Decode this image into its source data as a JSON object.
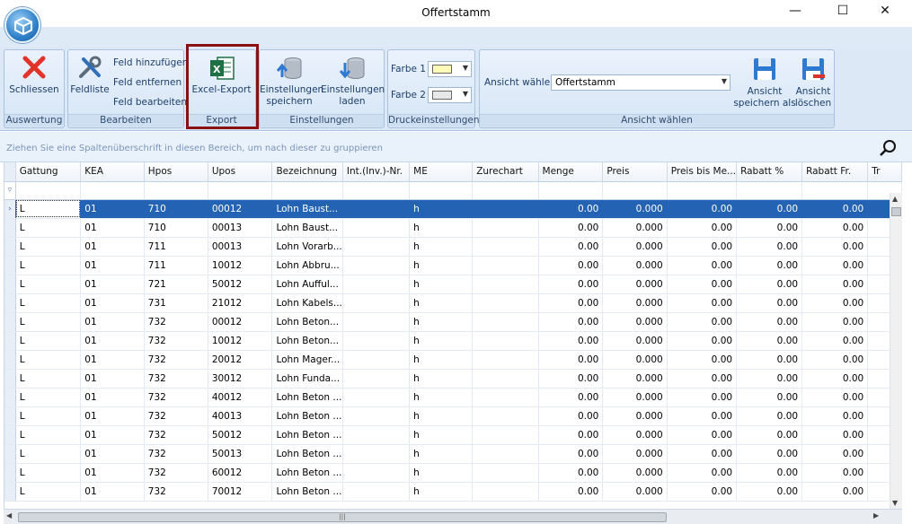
{
  "window": {
    "title": "Offertstamm",
    "minimize_glyph": "—",
    "maximize_glyph": "☐",
    "close_glyph": "✕"
  },
  "ribbon": {
    "auswertung": {
      "label": "Auswertung",
      "schliessen": "Schliessen"
    },
    "bearbeiten": {
      "label": "Bearbeiten",
      "feldliste": "Feldliste",
      "feld_hinzufuegen": "Feld hinzufügen",
      "feld_entfernen": "Feld entfernen",
      "feld_bearbeiten": "Feld bearbeiten"
    },
    "export": {
      "label": "Export",
      "excel_export": "Excel-Export"
    },
    "einstellungen": {
      "label": "Einstellungen",
      "speichern_l1": "Einstellungen",
      "speichern_l2": "speichern",
      "laden_l1": "Einstellungen",
      "laden_l2": "laden"
    },
    "druck": {
      "label": "Druckeinstellungen",
      "farbe1": "Farbe 1",
      "farbe2": "Farbe 2",
      "farbe1_color": "#fffbb8",
      "farbe2_color": "#e8e8e8"
    },
    "ansicht": {
      "label": "Ansicht wählen",
      "ansicht_waehlen": "Ansicht wählen",
      "selected": "Offertstamm",
      "speichern_l1": "Ansicht",
      "speichern_l2": "speichern als",
      "loeschen_l1": "Ansicht",
      "loeschen_l2": "löschen"
    }
  },
  "group_panel": {
    "hint": "Ziehen Sie eine Spaltenüberschrift in diesen Bereich, um nach dieser zu gruppieren"
  },
  "grid": {
    "columns": [
      "Gattung",
      "KEA",
      "Hpos",
      "Upos",
      "Bezeichnung",
      "Int.(Inv.)-Nr.",
      "ME",
      "Zurechart",
      "Menge",
      "Preis",
      "Preis bis Me...",
      "Rabatt %",
      "Rabatt Fr.",
      "Tr"
    ],
    "rows": [
      [
        "L",
        "01",
        "710",
        "00012",
        "Lohn Baust...",
        "",
        "h",
        "",
        "0.00",
        "0.000",
        "0.00",
        "0.00",
        "0.00"
      ],
      [
        "L",
        "01",
        "710",
        "00013",
        "Lohn Baust...",
        "",
        "h",
        "",
        "0.00",
        "0.000",
        "0.00",
        "0.00",
        "0.00"
      ],
      [
        "L",
        "01",
        "711",
        "00013",
        "Lohn Vorarb...",
        "",
        "h",
        "",
        "0.00",
        "0.000",
        "0.00",
        "0.00",
        "0.00"
      ],
      [
        "L",
        "01",
        "711",
        "10012",
        "Lohn Abbru...",
        "",
        "h",
        "",
        "0.00",
        "0.000",
        "0.00",
        "0.00",
        "0.00"
      ],
      [
        "L",
        "01",
        "721",
        "50012",
        "Lohn Aufful...",
        "",
        "h",
        "",
        "0.00",
        "0.000",
        "0.00",
        "0.00",
        "0.00"
      ],
      [
        "L",
        "01",
        "731",
        "21012",
        "Lohn Kabels...",
        "",
        "h",
        "",
        "0.00",
        "0.000",
        "0.00",
        "0.00",
        "0.00"
      ],
      [
        "L",
        "01",
        "732",
        "00012",
        "Lohn Beton...",
        "",
        "h",
        "",
        "0.00",
        "0.000",
        "0.00",
        "0.00",
        "0.00"
      ],
      [
        "L",
        "01",
        "732",
        "10012",
        "Lohn Beton...",
        "",
        "h",
        "",
        "0.00",
        "0.000",
        "0.00",
        "0.00",
        "0.00"
      ],
      [
        "L",
        "01",
        "732",
        "20012",
        "Lohn Mager...",
        "",
        "h",
        "",
        "0.00",
        "0.000",
        "0.00",
        "0.00",
        "0.00"
      ],
      [
        "L",
        "01",
        "732",
        "30012",
        "Lohn Funda...",
        "",
        "h",
        "",
        "0.00",
        "0.000",
        "0.00",
        "0.00",
        "0.00"
      ],
      [
        "L",
        "01",
        "732",
        "40012",
        "Lohn Beton ...",
        "",
        "h",
        "",
        "0.00",
        "0.000",
        "0.00",
        "0.00",
        "0.00"
      ],
      [
        "L",
        "01",
        "732",
        "40013",
        "Lohn Beton ...",
        "",
        "h",
        "",
        "0.00",
        "0.000",
        "0.00",
        "0.00",
        "0.00"
      ],
      [
        "L",
        "01",
        "732",
        "50012",
        "Lohn Beton ...",
        "",
        "h",
        "",
        "0.00",
        "0.000",
        "0.00",
        "0.00",
        "0.00"
      ],
      [
        "L",
        "01",
        "732",
        "50013",
        "Lohn Beton ...",
        "",
        "h",
        "",
        "0.00",
        "0.000",
        "0.00",
        "0.00",
        "0.00"
      ],
      [
        "L",
        "01",
        "732",
        "60012",
        "Lohn Beton ...",
        "",
        "h",
        "",
        "0.00",
        "0.000",
        "0.00",
        "0.00",
        "0.00"
      ],
      [
        "L",
        "01",
        "732",
        "70012",
        "Lohn Beton ...",
        "",
        "h",
        "",
        "0.00",
        "0.000",
        "0.00",
        "0.00",
        "0.00"
      ]
    ]
  }
}
